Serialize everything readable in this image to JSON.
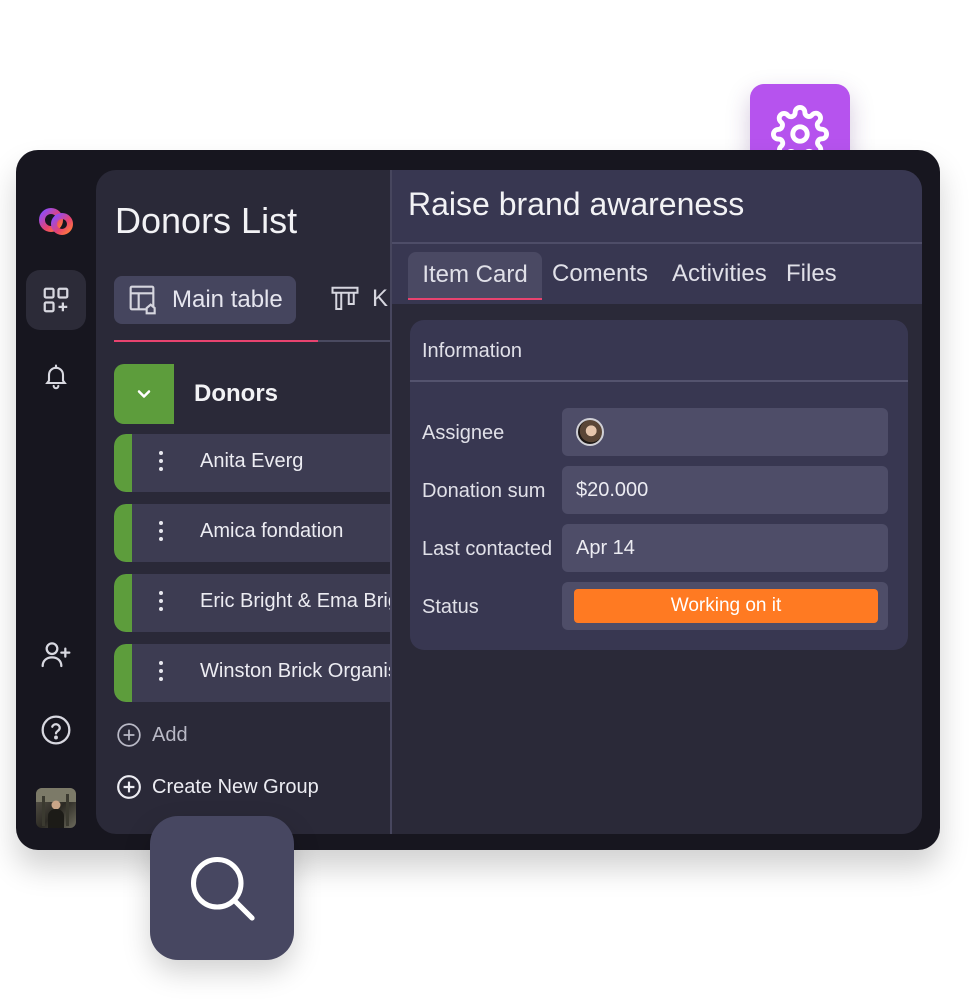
{
  "board": {
    "title": "Donors List",
    "views": [
      {
        "label": "Main table",
        "icon": "table-home-icon"
      },
      {
        "label": "K",
        "icon": "kanban-icon"
      }
    ],
    "group": {
      "name": "Donors"
    },
    "items": [
      {
        "name": "Anita Everg"
      },
      {
        "name": "Amica fondation"
      },
      {
        "name": "Eric Bright & Ema Brig"
      },
      {
        "name": "Winston Brick Organis"
      }
    ],
    "add_label": "Add",
    "create_group_label": "Create New Group"
  },
  "item_panel": {
    "title": "Raise brand awareness",
    "tabs": [
      "Item Card",
      "Coments",
      "Activities",
      "Files"
    ],
    "section_title": "Information",
    "fields": {
      "assignee_label": "Assignee",
      "donation_label": "Donation sum",
      "donation_value": "$20.000",
      "contacted_label": "Last contacted",
      "contacted_value": "Apr 14",
      "status_label": "Status",
      "status_value": "Working on it"
    }
  },
  "colors": {
    "accent_pink": "#e8436f",
    "group_green": "#5d9d3c",
    "status_orange": "#ff7a22",
    "settings_purple": "#b653ee"
  }
}
